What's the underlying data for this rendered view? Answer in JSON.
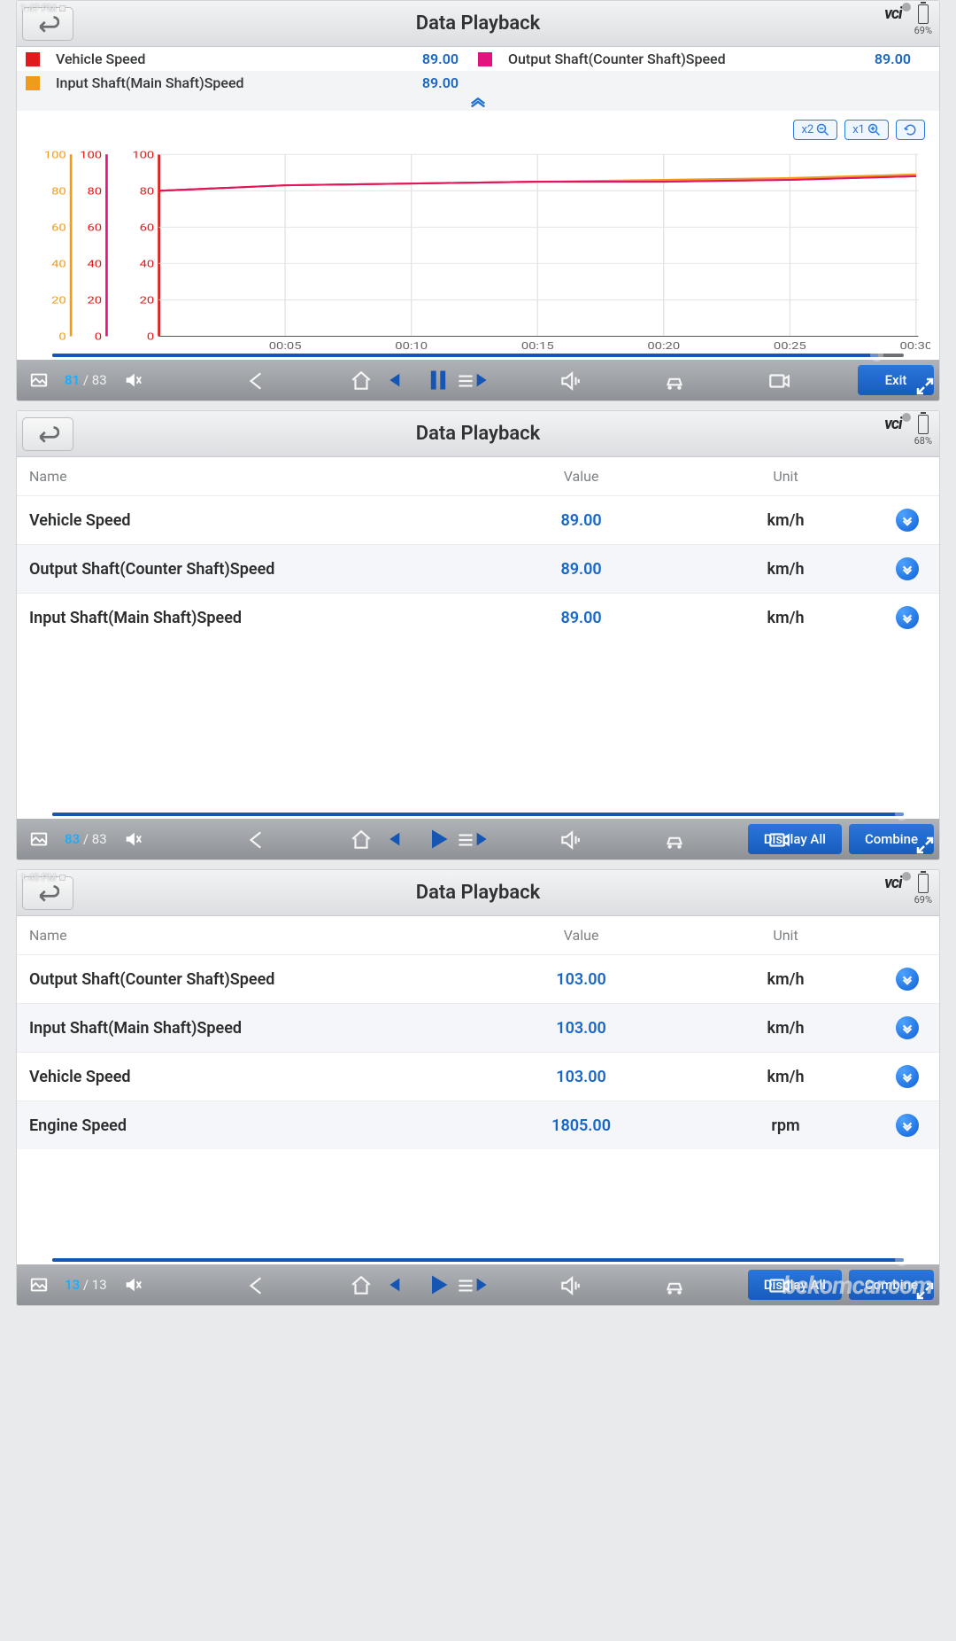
{
  "panels": [
    {
      "time": "1:47 PM",
      "title": "Data Playback",
      "battery": "69%",
      "vci": "vci",
      "legend": [
        {
          "color": "#e11b1b",
          "name": "Vehicle Speed",
          "value": "89.00"
        },
        {
          "color": "#e2137f",
          "name": "Output Shaft(Counter Shaft)Speed",
          "value": "89.00"
        },
        {
          "color": "#ef9c1a",
          "name": "Input Shaft(Main Shaft)Speed",
          "value": "89.00"
        }
      ],
      "chart_controls": {
        "zoom_out": "x2",
        "zoom_in": "x1"
      },
      "frame": {
        "cur": "81",
        "tot": "83"
      },
      "exit": "Exit"
    },
    {
      "time": "",
      "title": "Data Playback",
      "battery": "68%",
      "vci": "vci",
      "columns": {
        "name": "Name",
        "value": "Value",
        "unit": "Unit"
      },
      "rows": [
        {
          "name": "Vehicle Speed",
          "value": "89.00",
          "unit": "km/h"
        },
        {
          "name": "Output Shaft(Counter Shaft)Speed",
          "value": "89.00",
          "unit": "km/h"
        },
        {
          "name": "Input Shaft(Main Shaft)Speed",
          "value": "89.00",
          "unit": "km/h"
        }
      ],
      "frame": {
        "cur": "83",
        "tot": "83"
      },
      "display_all": "Display All",
      "combine": "Combine"
    },
    {
      "time": "1:45 PM",
      "title": "Data Playback",
      "battery": "69%",
      "vci": "vci",
      "columns": {
        "name": "Name",
        "value": "Value",
        "unit": "Unit"
      },
      "rows": [
        {
          "name": "Output Shaft(Counter Shaft)Speed",
          "value": "103.00",
          "unit": "km/h"
        },
        {
          "name": "Input Shaft(Main Shaft)Speed",
          "value": "103.00",
          "unit": "km/h"
        },
        {
          "name": "Vehicle Speed",
          "value": "103.00",
          "unit": "km/h"
        },
        {
          "name": "Engine Speed",
          "value": "1805.00",
          "unit": "rpm"
        }
      ],
      "frame": {
        "cur": "13",
        "tot": "13"
      },
      "display_all": "Display All",
      "combine": "Combine",
      "watermark": "bekomcar.com"
    }
  ],
  "chart_data": {
    "type": "line",
    "xlabel": "",
    "ylabel": "",
    "x_ticks": [
      "00:05",
      "00:10",
      "00:15",
      "00:20",
      "00:25",
      "00:30"
    ],
    "y_ticks_left1": [
      0,
      20,
      40,
      60,
      80,
      100
    ],
    "y_ticks_left2": [
      0,
      20,
      40,
      60,
      80,
      100
    ],
    "y_ticks_left3": [
      0,
      20,
      40,
      60,
      80,
      100
    ],
    "ylim": [
      0,
      100
    ],
    "series": [
      {
        "name": "Vehicle Speed",
        "color": "#e11b1b",
        "x": [
          0,
          5,
          10,
          15,
          20,
          25,
          30
        ],
        "values": [
          80,
          83,
          84,
          85,
          85,
          86,
          88
        ]
      },
      {
        "name": "Output Shaft(Counter Shaft)Speed",
        "color": "#e2137f",
        "x": [
          0,
          5,
          10,
          15,
          20,
          25,
          30
        ],
        "values": [
          80,
          83,
          84,
          85,
          85,
          86,
          88
        ]
      },
      {
        "name": "Input Shaft(Main Shaft)Speed",
        "color": "#ef9c1a",
        "x": [
          0,
          5,
          10,
          15,
          20,
          25,
          30
        ],
        "values": [
          80,
          83,
          84,
          85,
          86,
          87,
          89
        ]
      }
    ]
  }
}
